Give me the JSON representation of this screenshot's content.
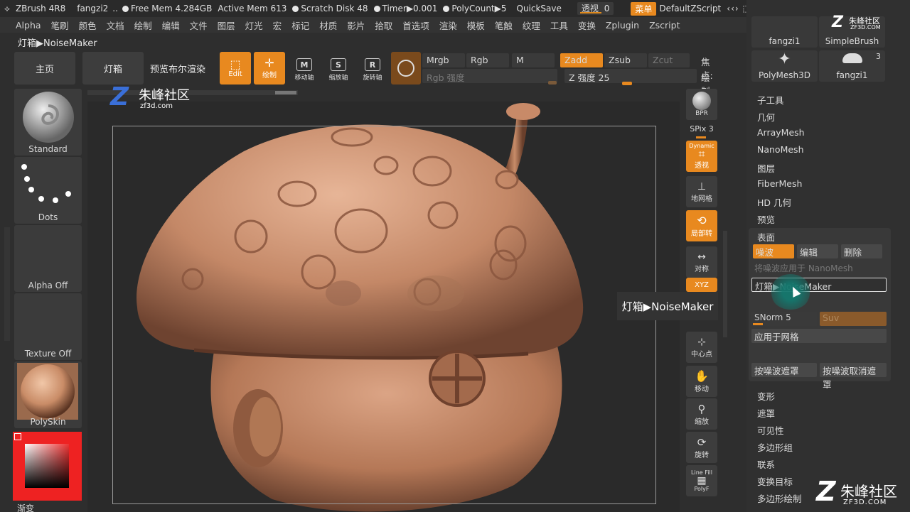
{
  "titlebar": {
    "app": "ZBrush 4R8",
    "doc": "fangzi2",
    "free_mem": "Free Mem 4.284GB",
    "active_mem": "Active Mem 613",
    "scratch": "Scratch Disk 48",
    "timer": "Timer▶0.001",
    "polycount": "PolyCount▶5",
    "quicksave": "QuickSave",
    "perspective": "透视",
    "perspective_value": "0",
    "menu_btn": "菜单",
    "script": "DefaultZScript"
  },
  "menubar": [
    "Alpha",
    "笔刷",
    "颜色",
    "文档",
    "绘制",
    "编辑",
    "文件",
    "图层",
    "灯光",
    "宏",
    "标记",
    "材质",
    "影片",
    "拾取",
    "首选项",
    "渲染",
    "模板",
    "笔触",
    "纹理",
    "工具",
    "变换",
    "Zplugin",
    "Zscript"
  ],
  "breadcrumb": "灯箱▶NoiseMaker",
  "toolbar": {
    "home": "主页",
    "lightbox": "灯箱",
    "bpr_preview": "预览布尔渲染",
    "edit": "Edit",
    "draw": "绘制",
    "move": "移动轴",
    "scale": "缩放轴",
    "rotate": "旋转轴",
    "mrgb": "Mrgb",
    "rgb": "Rgb",
    "m": "M",
    "rgb_intensity": "Rgb 强度",
    "zadd": "Zadd",
    "zsub": "Zsub",
    "zcut": "Zcut",
    "z_intensity": "Z 强度 25",
    "focal": "焦点:",
    "draw_size": "绘制:"
  },
  "left_shelf": {
    "brush": "Standard",
    "stroke": "Dots",
    "alpha": "Alpha Off",
    "texture": "Texture Off",
    "material": "PolySkin",
    "gradient": "渐变"
  },
  "right_tools": {
    "bpr": "BPR",
    "spix": "SPix 3",
    "dynamic": "Dynamic",
    "persp": "透视",
    "floor": "地网格",
    "local": "局部转",
    "sym": "对称",
    "xyz": "XYZ",
    "center": "中心点",
    "move": "移动",
    "zoom": "缩放",
    "rotate": "旋转",
    "linefill": "Line Fill",
    "polyf": "PolyF"
  },
  "right_panel": {
    "thumbs": [
      {
        "label": "fangzi1"
      },
      {
        "label": "SimpleBrush"
      },
      {
        "label": "PolyMesh3D"
      },
      {
        "label": "fangzi1",
        "badge": "3"
      }
    ],
    "list_top": [
      "子工具",
      "几何",
      "ArrayMesh",
      "NanoMesh",
      "图层",
      "FiberMesh",
      "HD 几何",
      "预览"
    ],
    "surface": {
      "title": "表面",
      "noise": "噪波",
      "edit": "编辑",
      "delete": "删除",
      "apply_nano": "将噪波应用于 NanoMesh",
      "lightbox_noise": "灯箱▶NoiseMaker",
      "snorm": "SNorm 5",
      "suv": "Suv",
      "apply_mesh": "应用于网格",
      "mask_by_noise": "按噪波遮罩",
      "unmask_by_noise": "按噪波取消遮罩"
    },
    "list_bottom": [
      "变形",
      "遮罩",
      "可见性",
      "多边形组",
      "联系",
      "变换目标",
      "多边形绘制"
    ]
  },
  "tooltip": "灯箱▶NoiseMaker",
  "watermarks": {
    "top_cn": "朱峰社区",
    "top_url": "zf3d.com",
    "bottom_cn": "朱峰社区",
    "bottom_url": "ZF3D.COM",
    "corner_cn": "朱峰社区",
    "corner_url": "ZF3D.COM"
  },
  "colors": {
    "accent": "#e8891f",
    "panel": "#303030",
    "bg": "#2e2e2e"
  }
}
